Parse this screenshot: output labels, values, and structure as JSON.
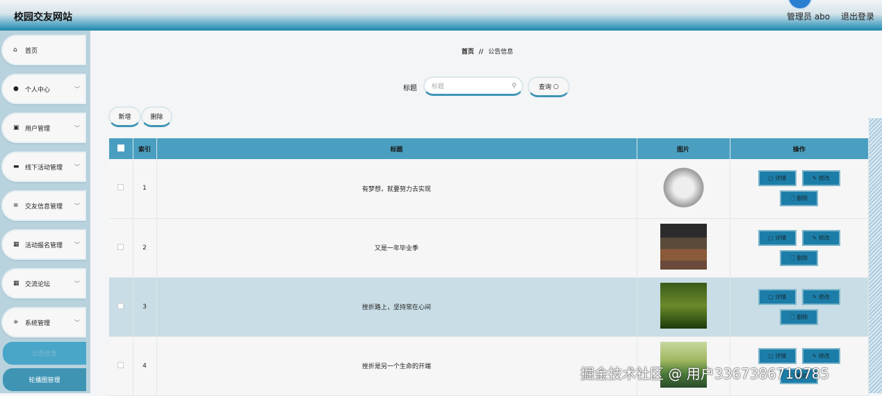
{
  "header": {
    "title": "校园交友网站",
    "user": "管理员 abo",
    "logout": "退出登录"
  },
  "sidebar": {
    "items": [
      {
        "label": "首页",
        "icon": "home-icon",
        "glyph": "⌂"
      },
      {
        "label": "个人中心",
        "icon": "user-icon",
        "glyph": "●"
      },
      {
        "label": "用户管理",
        "icon": "clipboard-icon",
        "glyph": "▣"
      },
      {
        "label": "线下活动管理",
        "icon": "briefcase-icon",
        "glyph": "▬"
      },
      {
        "label": "交友信息管理",
        "icon": "list-icon",
        "glyph": "≡"
      },
      {
        "label": "活动报名管理",
        "icon": "grid-icon",
        "glyph": "▦"
      },
      {
        "label": "交流论坛",
        "icon": "grid-icon",
        "glyph": "▦"
      },
      {
        "label": "系统管理",
        "icon": "sliders-icon",
        "glyph": "≑"
      }
    ],
    "chevron": "﹀",
    "subitems": [
      {
        "label": "公告信息"
      },
      {
        "label": "轮播图管理"
      }
    ]
  },
  "breadcrumb": {
    "home": "首页",
    "sep": "//",
    "current": "公告信息"
  },
  "search": {
    "label": "标题",
    "placeholder": "标题",
    "button": "查询"
  },
  "toolbar": {
    "add": "新增",
    "delete": "删除"
  },
  "table": {
    "headers": [
      "索引",
      "标题",
      "图片",
      "操作"
    ],
    "rows": [
      {
        "index": "1",
        "title": "有梦想，就要努力去实现",
        "image": "news"
      },
      {
        "index": "2",
        "title": "又是一年毕业季",
        "image": "classroom"
      },
      {
        "index": "3",
        "title": "挫折路上，坚持常在心间",
        "image": "park"
      },
      {
        "index": "4",
        "title": "挫折是另一个生命的开端",
        "image": "sunset"
      }
    ],
    "actions": {
      "detail": "详情",
      "edit": "修改",
      "delete": "删除"
    }
  },
  "watermark": "掘金技术社区 @ 用户3367386710785"
}
